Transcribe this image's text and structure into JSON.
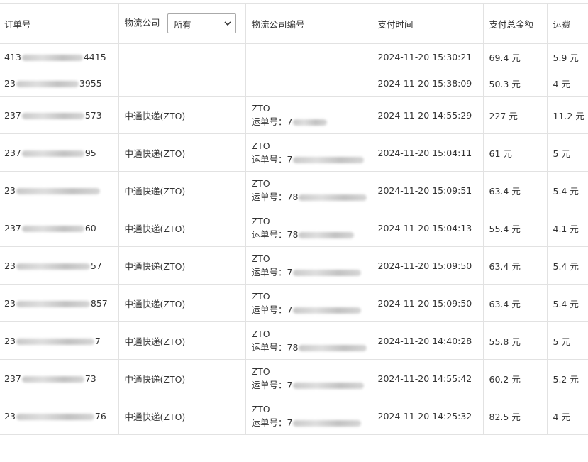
{
  "headers": {
    "order_no": "订单号",
    "company": "物流公司",
    "company_filter": "所有",
    "company_code": "物流公司编号",
    "pay_time": "支付时间",
    "total_amount": "支付总金额",
    "shipping": "运费"
  },
  "labels": {
    "waybill_prefix": "运单号：",
    "currency": "元"
  },
  "rows": [
    {
      "order_start": "413",
      "order_end": "4415",
      "company": "",
      "code": "",
      "waybill_start": "",
      "pay_time": "2024-11-20 15:30:21",
      "amount": "69.4",
      "shipping": "5.9"
    },
    {
      "order_start": "23",
      "order_end": "3955",
      "company": "",
      "code": "",
      "waybill_start": "",
      "pay_time": "2024-11-20 15:38:09",
      "amount": "50.3",
      "shipping": "4"
    },
    {
      "order_start": "237",
      "order_end": "573",
      "company": "中通快递(ZTO)",
      "code": "ZTO",
      "waybill_start": "7",
      "pay_time": "2024-11-20 14:55:29",
      "amount": "227",
      "shipping": "11.2"
    },
    {
      "order_start": "237",
      "order_end": "95",
      "company": "中通快递(ZTO)",
      "code": "ZTO",
      "waybill_start": "7",
      "pay_time": "2024-11-20 15:04:11",
      "amount": "61",
      "shipping": "5"
    },
    {
      "order_start": "23",
      "order_end": "",
      "company": "中通快递(ZTO)",
      "code": "ZTO",
      "waybill_start": "78",
      "pay_time": "2024-11-20 15:09:51",
      "amount": "63.4",
      "shipping": "5.4"
    },
    {
      "order_start": "237",
      "order_end": "60",
      "company": "中通快递(ZTO)",
      "code": "ZTO",
      "waybill_start": "78",
      "pay_time": "2024-11-20 15:04:13",
      "amount": "55.4",
      "shipping": "4.1"
    },
    {
      "order_start": "23",
      "order_end": "57",
      "company": "中通快递(ZTO)",
      "code": "ZTO",
      "waybill_start": "7",
      "pay_time": "2024-11-20 15:09:50",
      "amount": "63.4",
      "shipping": "5.4"
    },
    {
      "order_start": "23",
      "order_end": "857",
      "company": "中通快递(ZTO)",
      "code": "ZTO",
      "waybill_start": "7",
      "pay_time": "2024-11-20 15:09:50",
      "amount": "63.4",
      "shipping": "5.4"
    },
    {
      "order_start": "23",
      "order_end": "7",
      "company": "中通快递(ZTO)",
      "code": "ZTO",
      "waybill_start": "78",
      "pay_time": "2024-11-20 14:40:28",
      "amount": "55.8",
      "shipping": "5"
    },
    {
      "order_start": "237",
      "order_end": "73",
      "company": "中通快递(ZTO)",
      "code": "ZTO",
      "waybill_start": "7",
      "pay_time": "2024-11-20 14:55:42",
      "amount": "60.2",
      "shipping": "5.2"
    },
    {
      "order_start": "23",
      "order_end": "76",
      "company": "中通快递(ZTO)",
      "code": "ZTO",
      "waybill_start": "7",
      "pay_time": "2024-11-20 14:25:32",
      "amount": "82.5",
      "shipping": "4"
    }
  ]
}
